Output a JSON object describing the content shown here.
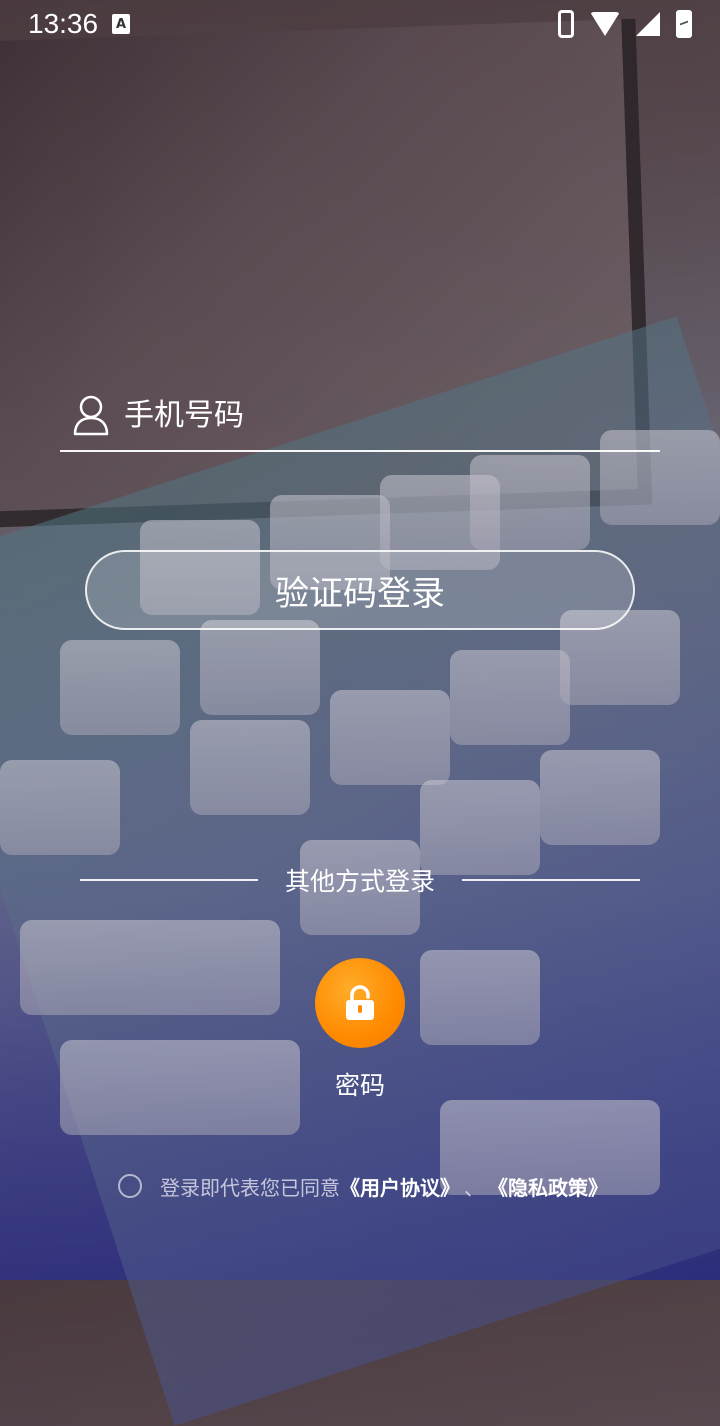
{
  "status_bar": {
    "time": "13:36",
    "notification_icon_letter": "A",
    "icons": [
      "phone-icon",
      "wifi-icon",
      "signal-icon",
      "battery-charging-icon"
    ]
  },
  "login_form": {
    "phone_placeholder": "手机号码",
    "phone_value": "",
    "submit_label": "验证码登录"
  },
  "other_login": {
    "title": "其他方式登录",
    "password_option": {
      "label": "密码",
      "icon": "lock-icon",
      "color": "#ff8a00"
    }
  },
  "agreement": {
    "checked": false,
    "prefix": "登录即代表您已同意",
    "user_agreement": "《用户协议》",
    "separator": "、",
    "privacy_policy": "《隐私政策》"
  }
}
